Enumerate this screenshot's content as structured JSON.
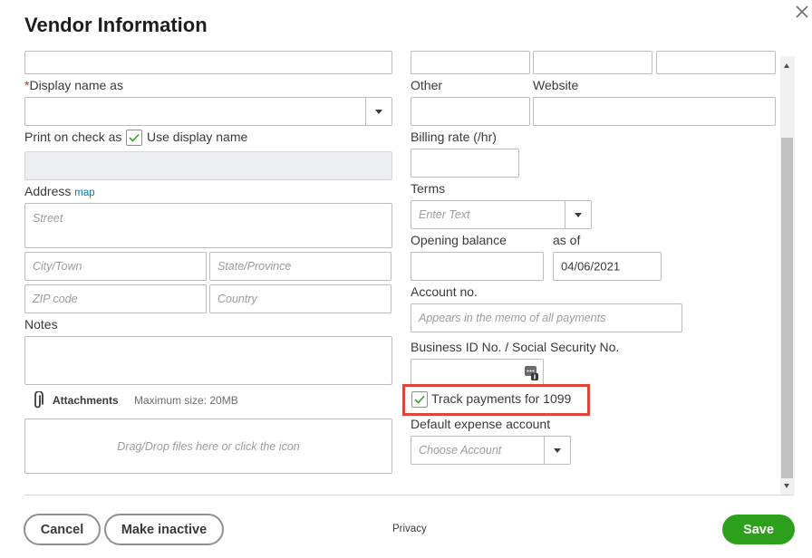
{
  "dialog": {
    "title": "Vendor Information"
  },
  "left": {
    "display_name_label": "Display name as",
    "print_on_check_label": "Print on check as",
    "use_display_name_label": "Use display name",
    "address_label": "Address",
    "map_link": "map",
    "street_placeholder": "Street",
    "city_placeholder": "City/Town",
    "state_placeholder": "State/Province",
    "zip_placeholder": "ZIP code",
    "country_placeholder": "Country",
    "notes_label": "Notes",
    "attachments_label": "Attachments",
    "max_size": "Maximum size: 20MB",
    "dropzone_text": "Drag/Drop files here or click the icon"
  },
  "right": {
    "other_label": "Other",
    "website_label": "Website",
    "billing_rate_label": "Billing rate (/hr)",
    "terms_label": "Terms",
    "terms_placeholder": "Enter Text",
    "opening_balance_label": "Opening balance",
    "as_of_label": "as of",
    "as_of_value": "04/06/2021",
    "account_no_label": "Account no.",
    "account_no_placeholder": "Appears in the memo of all payments",
    "business_id_label": "Business ID No. / Social Security No.",
    "track_1099_label": "Track payments for 1099",
    "default_expense_label": "Default expense account",
    "choose_account_placeholder": "Choose Account"
  },
  "footer": {
    "cancel": "Cancel",
    "make_inactive": "Make inactive",
    "privacy": "Privacy",
    "save": "Save"
  },
  "colors": {
    "save_green": "#2ca01c",
    "link_blue": "#0077c5",
    "required_red": "#d52b1e",
    "highlight_red": "#e0453a",
    "check_green": "#2ca01c"
  },
  "icons": [
    "close-icon",
    "chevron-down-icon",
    "checkmark-icon",
    "paperclip-icon",
    "id-card-icon"
  ]
}
